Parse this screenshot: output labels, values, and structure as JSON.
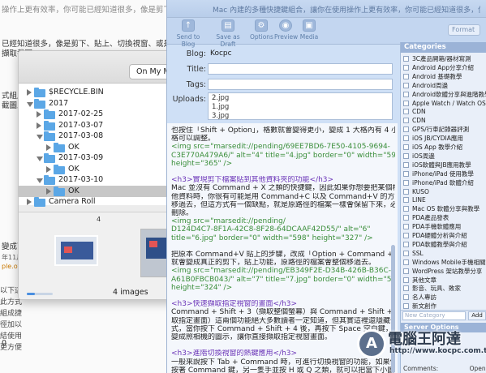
{
  "background": {
    "top_line": "操作上更有效率，你可能已經知道很多，像是剪下、",
    "line1": "已經知道很多，像是剪下、貼上、切換視窗、或是擷取",
    "line2": "擷取截圖...",
    "line3": "式組成",
    "line4": "截圖上",
    "line5": "變成下",
    "line6": "年11月",
    "line7": "ple.of.H",
    "bottom_left": "0",
    "side_text": "以下這此方式組成捷徑加以結使用更方便"
  },
  "finder": {
    "location_button": "On My Ma",
    "tree": [
      {
        "label": "$RECYCLE.BIN",
        "type": "folder",
        "indent": 0,
        "expanded": false,
        "selected": false
      },
      {
        "label": "2017",
        "type": "folder",
        "indent": 0,
        "expanded": true,
        "selected": false
      },
      {
        "label": "2017-02-25",
        "type": "folder",
        "indent": 1,
        "expanded": false,
        "selected": false
      },
      {
        "label": "2017-03-07",
        "type": "folder",
        "indent": 1,
        "expanded": false,
        "selected": false
      },
      {
        "label": "2017-03-08",
        "type": "folder",
        "indent": 1,
        "expanded": true,
        "selected": false
      },
      {
        "label": "OK",
        "type": "folder",
        "indent": 2,
        "expanded": false,
        "selected": false
      },
      {
        "label": "2017-03-09",
        "type": "folder",
        "indent": 1,
        "expanded": true,
        "selected": false
      },
      {
        "label": "OK",
        "type": "folder",
        "indent": 2,
        "expanded": false,
        "selected": false
      },
      {
        "label": "2017-03-10",
        "type": "folder",
        "indent": 1,
        "expanded": true,
        "selected": false
      },
      {
        "label": "OK",
        "type": "folder",
        "indent": 2,
        "expanded": false,
        "selected": true
      },
      {
        "label": "Camera Roll",
        "type": "folder",
        "indent": 0,
        "expanded": false,
        "selected": false
      }
    ],
    "preview_index": "4",
    "image_count": "4 images",
    "zoom_level": 0.3
  },
  "marsedit": {
    "title_text": "Mac 內建的多種快捷鍵組合，讓你在使用操作上更有效率，你可能已經知道很多，像是剪下、貼上、切換視窗",
    "toolbar": [
      {
        "label": "Send to Blog",
        "icon": "send-icon"
      },
      {
        "label": "Save as Draft",
        "icon": "save-icon"
      },
      {
        "label": "Options",
        "icon": "options-icon"
      },
      {
        "label": "Preview",
        "icon": "preview-icon"
      },
      {
        "label": "Media",
        "icon": "media-icon"
      }
    ],
    "format_label": "Format",
    "fields": {
      "blog_label": "Blog:",
      "blog_value": "Kocpc",
      "title_label": "Title:",
      "title_value": "",
      "tags_label": "Tags:",
      "tags_value": "",
      "uploads_label": "Uploads:",
      "uploads": [
        "2.jpg",
        "1.jpg",
        "3.jpg"
      ]
    },
    "editor_lines": [
      {
        "text": "也按住「Shift + Option」，格數就會變得更小，變成 1 大格內有 4 小",
        "kind": "txt"
      },
      {
        "text": "格可以調整。",
        "kind": "txt"
      },
      {
        "text": "<img src=\"marsedit://pending/69EE7BD6-7E50-4105-9694-",
        "kind": "code"
      },
      {
        "text": "C3E770A479A6/\" alt=\"4\" title=\"4.jpg\" border=\"0\" width=\"598\"",
        "kind": "code"
      },
      {
        "text": "height=\"365\" />",
        "kind": "code"
      },
      {
        "text": "",
        "kind": "txt"
      },
      {
        "text": "<h3>實現剪下檔案貼到其他資料夾的功能</h3>",
        "kind": "tag"
      },
      {
        "text": "Mac 並沒有 Command + X 之類的快捷鍵，因此如果你想要把某個檔案移到其",
        "kind": "txt"
      },
      {
        "text": "他資料時，你很有可能是用 Command+C 以及 Command+V 的方式，把檔案",
        "kind": "txt"
      },
      {
        "text": "移過去，但這方式有一個缺點，就是原路徑的檔案一樣會保留下來，必須手動",
        "kind": "txt"
      },
      {
        "text": "刪除。",
        "kind": "txt"
      },
      {
        "text": "<img src=\"marsedit://pending/",
        "kind": "code"
      },
      {
        "text": "D124D4C7-8F1A-42C8-8F28-64DCAAF42D55/\" alt=\"6\"",
        "kind": "code"
      },
      {
        "text": "title=\"6.jpg\" border=\"0\" width=\"598\" height=\"327\" />",
        "kind": "code"
      },
      {
        "text": "",
        "kind": "txt"
      },
      {
        "text": "把原本 Command+V 貼上的步驟，改成「Option + Command +V」快捷鍵，",
        "kind": "txt"
      },
      {
        "text": "就會變成真正的剪下，貼上功能，原路徑的檔案會整個移過去。",
        "kind": "txt"
      },
      {
        "text": "<img src=\"marsedit://pending/EB349F2E-D34B-426B-B36C-",
        "kind": "code"
      },
      {
        "text": "A61B0FBCB043/\" alt=\"7\" title=\"7.jpg\" border=\"0\" width=\"598\"",
        "kind": "code"
      },
      {
        "text": "height=\"324\" />",
        "kind": "code"
      },
      {
        "text": "",
        "kind": "txt"
      },
      {
        "text": "<h3>快速擷取指定視窗的畫面</h3>",
        "kind": "tag"
      },
      {
        "text": "Command + Shift + 3（擷取整個螢幕）與 Command + Shift + 4（擷",
        "kind": "txt"
      },
      {
        "text": "取指定畫面）這兩個功能絕大多數讀者一定知道，但其實這裡還隱藏一個模",
        "kind": "txt"
      },
      {
        "text": "式，當你按下 Command + Shift + 4 後，再按下 Space 空白鍵，就樣就會",
        "kind": "txt"
      },
      {
        "text": "變成照相機的圖示，讓你直接擷取指定視窗畫面。",
        "kind": "txt"
      },
      {
        "text": "",
        "kind": "txt"
      },
      {
        "text": "<h3>進階切換視窗的熱鍵應用</h3>",
        "kind": "tag"
      },
      {
        "text": "一般來說按下 Tab + Command 時，可進行切換視窗的功能，如果你",
        "kind": "txt"
      },
      {
        "text": "按著 Command 鍵，另一隻手並按 H 或 Q 之類，就可以把當下小圖示的視",
        "kind": "txt"
      }
    ],
    "categories_header": "Categories",
    "categories": [
      "3C產品開箱/器材寫測",
      "Android App分享介紹",
      "Android 基礎教學",
      "Android周邊",
      "Android軟體分享與進階教學",
      "Apple Watch / Watch OS",
      "CDN",
      "CDN",
      "GPS/行車記錄器評測",
      "iOS JB/CYDIA應用",
      "iOS App 教學介紹",
      "iOS周邊",
      "iOS軟體與JB應用教學",
      "iPhone/iPad 使用教學",
      "iPhone/iPad 軟體介紹",
      "KUSO",
      "LINE",
      "Mac OS 軟體分享與教學",
      "PDA產品發表",
      "PDA手機軟體應用",
      "PDA硬體分析與介紹",
      "PDA軟體教學與介紹",
      "SSL",
      "Windows Mobile手機相關文",
      "WordPress 架站教學分享",
      "其他文章",
      "影音、玩具、敗家",
      "名人專訪",
      "新文創作"
    ],
    "new_category_placeholder": "New Category",
    "add_label": "Add",
    "server_options_header": "Server Options",
    "comments_label": "Comments:",
    "comments_value": "Open"
  },
  "watermark": {
    "title": "電腦王阿達",
    "url": "http://www.kocpc.com.tw",
    "icon_glyph": "A"
  }
}
